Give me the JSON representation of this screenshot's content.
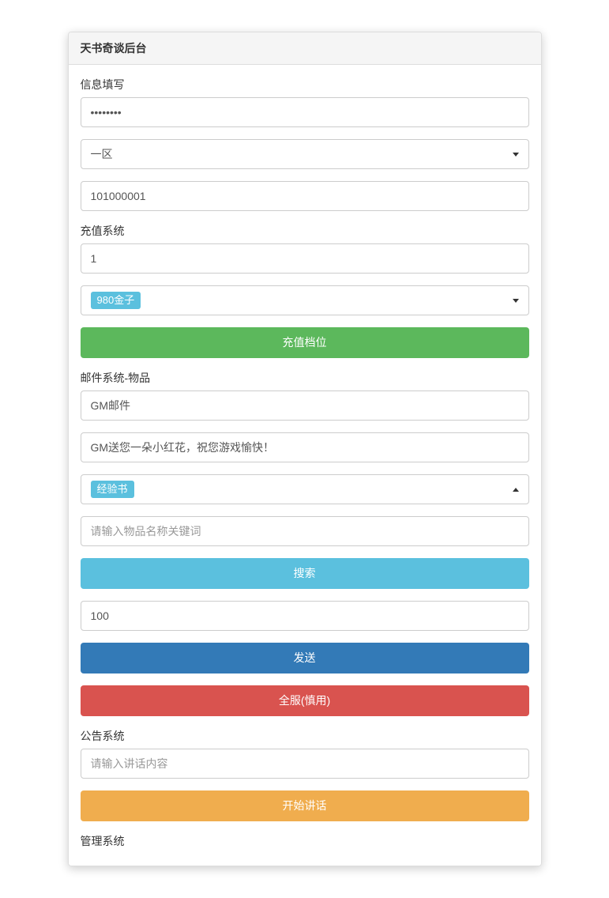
{
  "panel": {
    "title": "天书奇谈后台"
  },
  "info": {
    "label": "信息填写",
    "password_value": "••••••••",
    "zone_selected": "一区",
    "player_id": "101000001"
  },
  "recharge": {
    "label": "充值系统",
    "quantity": "1",
    "tier_selected": "980金子",
    "submit_label": "充值档位"
  },
  "mail": {
    "label": "邮件系统-物品",
    "title_value": "GM邮件",
    "body_value": "GM送您一朵小红花，祝您游戏愉快！",
    "item_selected": "经验书",
    "search_placeholder": "请输入物品名称关键词",
    "search_label": "搜索",
    "amount_value": "100",
    "send_label": "发送",
    "broadcast_label": "全服(慎用)"
  },
  "announce": {
    "label": "公告系统",
    "input_placeholder": "请输入讲话内容",
    "submit_label": "开始讲话"
  },
  "manage": {
    "label": "管理系统"
  }
}
